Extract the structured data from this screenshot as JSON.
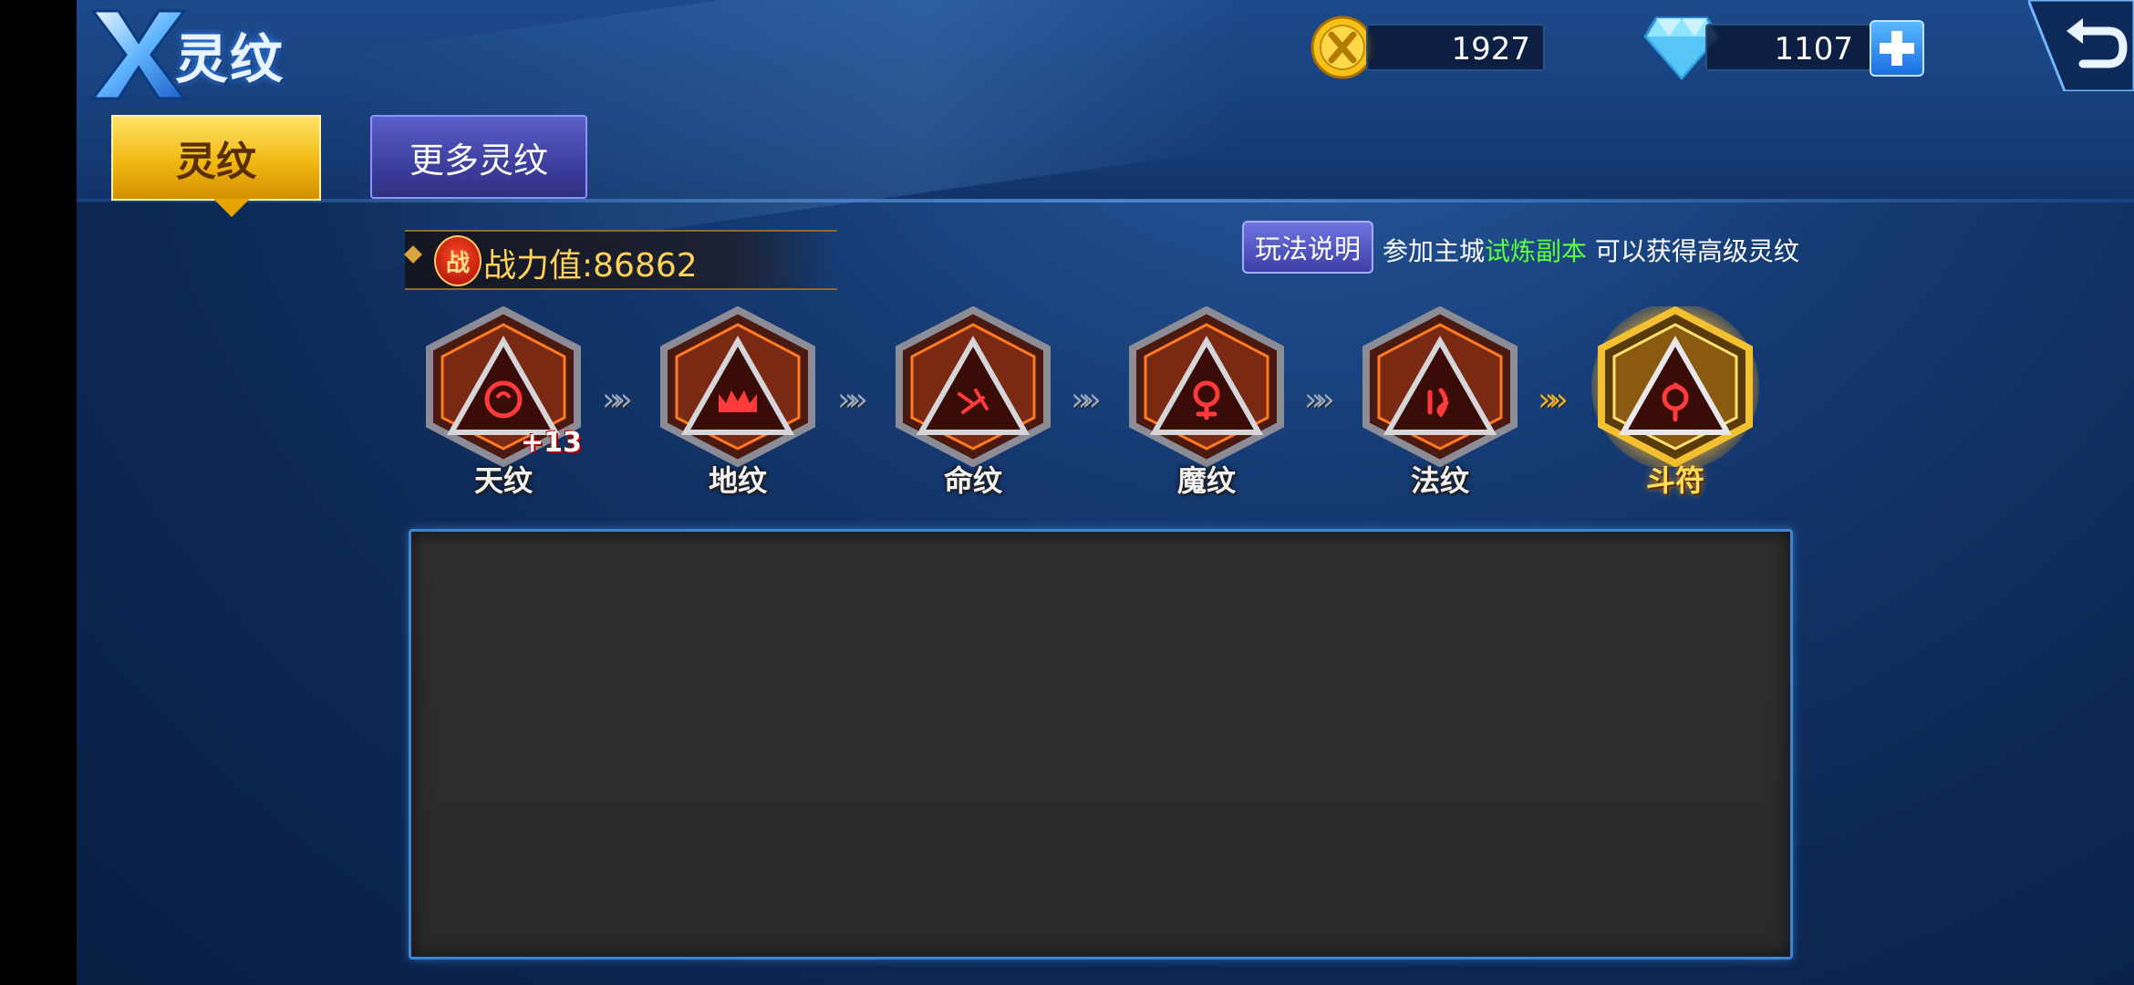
{
  "header": {
    "title": "灵纹"
  },
  "currency": {
    "gold": "1927",
    "diamond": "1107"
  },
  "tabs": [
    {
      "label": "灵纹"
    },
    {
      "label": "更多灵纹"
    }
  ],
  "power": {
    "badge": "战",
    "label": "战力值:86862"
  },
  "rules": {
    "button_label": "玩法说明",
    "hint_prefix": "参加主城",
    "hint_highlight": "试炼副本",
    "hint_suffix": " 可以获得高级灵纹"
  },
  "runes": [
    {
      "name": "天纹",
      "level": "+13",
      "icon": "swirl-rune-icon"
    },
    {
      "name": "地纹",
      "level": "",
      "icon": "crown-rune-icon"
    },
    {
      "name": "命纹",
      "level": "",
      "icon": "spirit-rune-icon"
    },
    {
      "name": "魔纹",
      "level": "",
      "icon": "demon-rune-icon"
    },
    {
      "name": "法纹",
      "level": "",
      "icon": "magic-rune-icon"
    },
    {
      "name": "斗符",
      "level": "",
      "icon": "fight-rune-icon"
    }
  ],
  "colors": {
    "tab_active": "#f1b812",
    "tab_inactive": "#3d3f9e",
    "power_text": "#ffd35a",
    "hint_highlight": "#5cff3a",
    "panel_border": "#3a86d0"
  }
}
